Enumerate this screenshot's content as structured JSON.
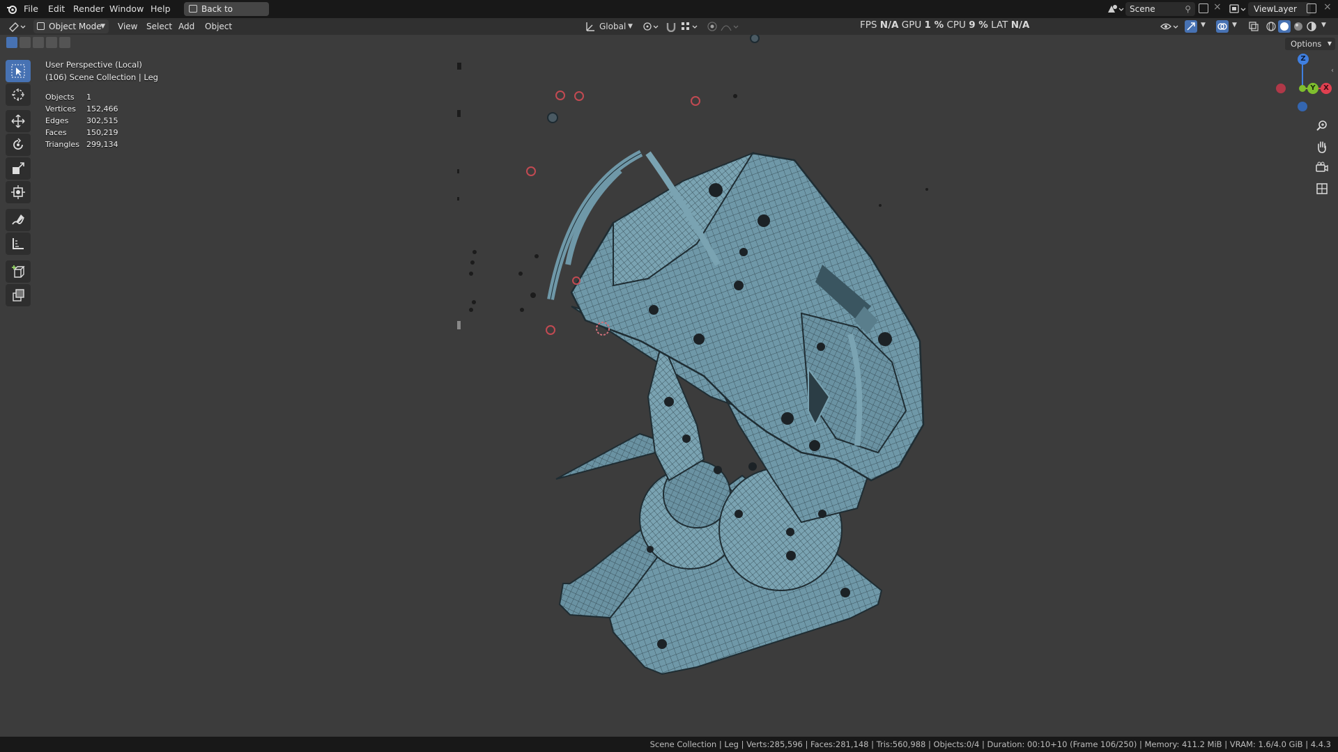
{
  "menu": {
    "file": "File",
    "edit": "Edit",
    "render": "Render",
    "window": "Window",
    "help": "Help",
    "back_to_previous": "Back to Previous"
  },
  "scene_field": "Scene",
  "view_layer_field": "ViewLayer",
  "header": {
    "mode": "Object Mode",
    "view": "View",
    "select": "Select",
    "add": "Add",
    "object": "Object",
    "transform_orientation": "Global",
    "options": "Options"
  },
  "perf": {
    "fps_label": "FPS",
    "fps": "N/A",
    "gpu_label": "GPU",
    "gpu": "1 %",
    "cpu_label": "CPU",
    "cpu": "9 %",
    "lat_label": "LAT",
    "lat": "N/A"
  },
  "viewport_info": {
    "view_name": "User Perspective (Local)",
    "collection": "(106) Scene Collection | Leg"
  },
  "stats": [
    {
      "label": "Objects",
      "value": "1"
    },
    {
      "label": "Vertices",
      "value": "152,466"
    },
    {
      "label": "Edges",
      "value": "302,515"
    },
    {
      "label": "Faces",
      "value": "150,219"
    },
    {
      "label": "Triangles",
      "value": "299,134"
    }
  ],
  "gizmo": {
    "z": "Z",
    "y": "Y",
    "x": "X"
  },
  "status": "Scene Collection | Leg | Verts:285,596 | Faces:281,148 | Tris:560,988 | Objects:0/4 | Duration: 00:10+10 (Frame 106/250) | Memory: 411.2 MiB | VRAM: 1.6/4.0 GiB | 4.4.3",
  "colors": {
    "accent": "#4772b3",
    "mesh": "#6f98a8",
    "wire": "#2a3c44",
    "x_axis": "#e04050",
    "y_axis": "#7fbf2e",
    "z_axis": "#3f7fe0"
  },
  "icons": [
    "blender-logo-icon",
    "select-box-icon",
    "cursor-icon",
    "move-icon",
    "rotate-icon",
    "scale-icon",
    "transform-icon",
    "annotate-icon",
    "measure-icon",
    "add-cube-icon",
    "extrude-icon",
    "zoom-icon",
    "hand-pan-icon",
    "camera-icon",
    "grid-view-icon"
  ]
}
